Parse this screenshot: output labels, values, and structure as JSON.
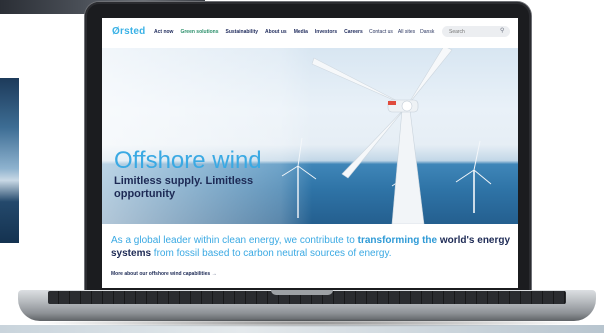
{
  "nav": {
    "logo": "Ørsted",
    "menu": [
      "Act now",
      "Green solutions",
      "Sustainability",
      "About us",
      "Media",
      "Investors",
      "Careers"
    ],
    "active_index": 1,
    "utility": [
      "Contact us",
      "All sites",
      "Dansk"
    ],
    "search_placeholder": "Search",
    "search_icon": "search-icon"
  },
  "hero": {
    "title": "Offshore wind",
    "subtitle": "Limitless supply. Limitless opportunity"
  },
  "intro": {
    "part1": "As a global leader within clean energy, we contribute to ",
    "highlight1": "transforming the",
    "highlight2": "world's energy systems",
    "part2": " from fossil based to carbon neutral sources of energy."
  },
  "link": {
    "more": "More about our offshore wind capabilities →"
  },
  "colors": {
    "brand_blue": "#3aa9e3",
    "navy": "#1d2a55",
    "active_green": "#2a8f6a"
  }
}
